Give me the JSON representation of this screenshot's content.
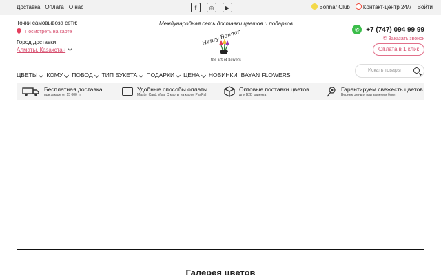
{
  "topbar": {
    "links": [
      "Доставка",
      "Оплата",
      "О нас"
    ],
    "social": [
      {
        "icon": "facebook-icon",
        "glyph": "f"
      },
      {
        "icon": "instagram-icon",
        "glyph": "◎"
      },
      {
        "icon": "youtube-icon",
        "glyph": "▶"
      }
    ],
    "club": "Bonnar Club",
    "contact_center": "Контакт-центр 24/7",
    "login": "Войти"
  },
  "pickup": {
    "label": "Точки самовывоза сети:",
    "map_link": "Посмотреть на карте"
  },
  "city": {
    "label": "Город доставки:",
    "value": "Алматы, Казахстан"
  },
  "header": {
    "tagline": "Международная сеть доставки цветов и подарков",
    "logo_sub": "the art of flowers"
  },
  "contact": {
    "phone": "+7 (747) 094 99 99",
    "callback": "Заказать звонок",
    "pay_one_click": "Оплата в 1 клик"
  },
  "nav": {
    "items": [
      {
        "label": "ЦВЕТЫ",
        "dropdown": true
      },
      {
        "label": "КОМУ",
        "dropdown": true
      },
      {
        "label": "ПОВОД",
        "dropdown": true
      },
      {
        "label": "ТИП БУКЕТА",
        "dropdown": true
      },
      {
        "label": "ПОДАРКИ",
        "dropdown": true
      },
      {
        "label": "ЦЕНА",
        "dropdown": true
      },
      {
        "label": "НОВИНКИ",
        "dropdown": false
      },
      {
        "label": "BAYAN FLOWERS",
        "dropdown": false
      }
    ]
  },
  "search": {
    "placeholder": "Искать товары"
  },
  "features": [
    {
      "title": "Бесплатная доставка",
      "sub": "при заказе от 15 000 тг"
    },
    {
      "title": "Удобные способы оплаты",
      "sub": "Master Card, Visa, С карты на карту, PayPal"
    },
    {
      "title": "Оптовые поставки цветов",
      "sub": "для B2B клиента"
    },
    {
      "title": "Гарантируем свежесть цветов",
      "sub": "Вернем деньги или заменим букет"
    }
  ],
  "gallery": {
    "title": "Галерея цветов"
  },
  "colors": {
    "accent": "#d64d6d",
    "whatsapp": "#3bbd4a",
    "topbar_bg": "#f2f2f2"
  }
}
